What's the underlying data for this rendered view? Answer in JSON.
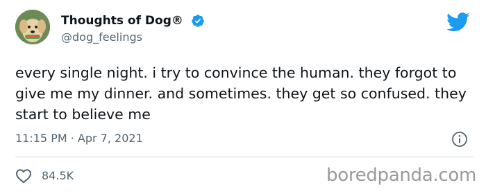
{
  "author": {
    "display_name": "Thoughts of Dog®",
    "handle": "@dog_feelings",
    "verified": true,
    "avatar_icon": "dog-avatar"
  },
  "tweet": {
    "text": "every single night. i try to convince the human. they forgot to give me my dinner. and sometimes. they get so confused. they start to believe me",
    "timestamp": "11:15 PM · Apr 7, 2021"
  },
  "engagement": {
    "likes": "84.5K"
  },
  "watermark": "boredpanda.com",
  "colors": {
    "twitter_blue": "#1d9bf0",
    "text_primary": "#0f1419",
    "text_secondary": "#536471"
  }
}
